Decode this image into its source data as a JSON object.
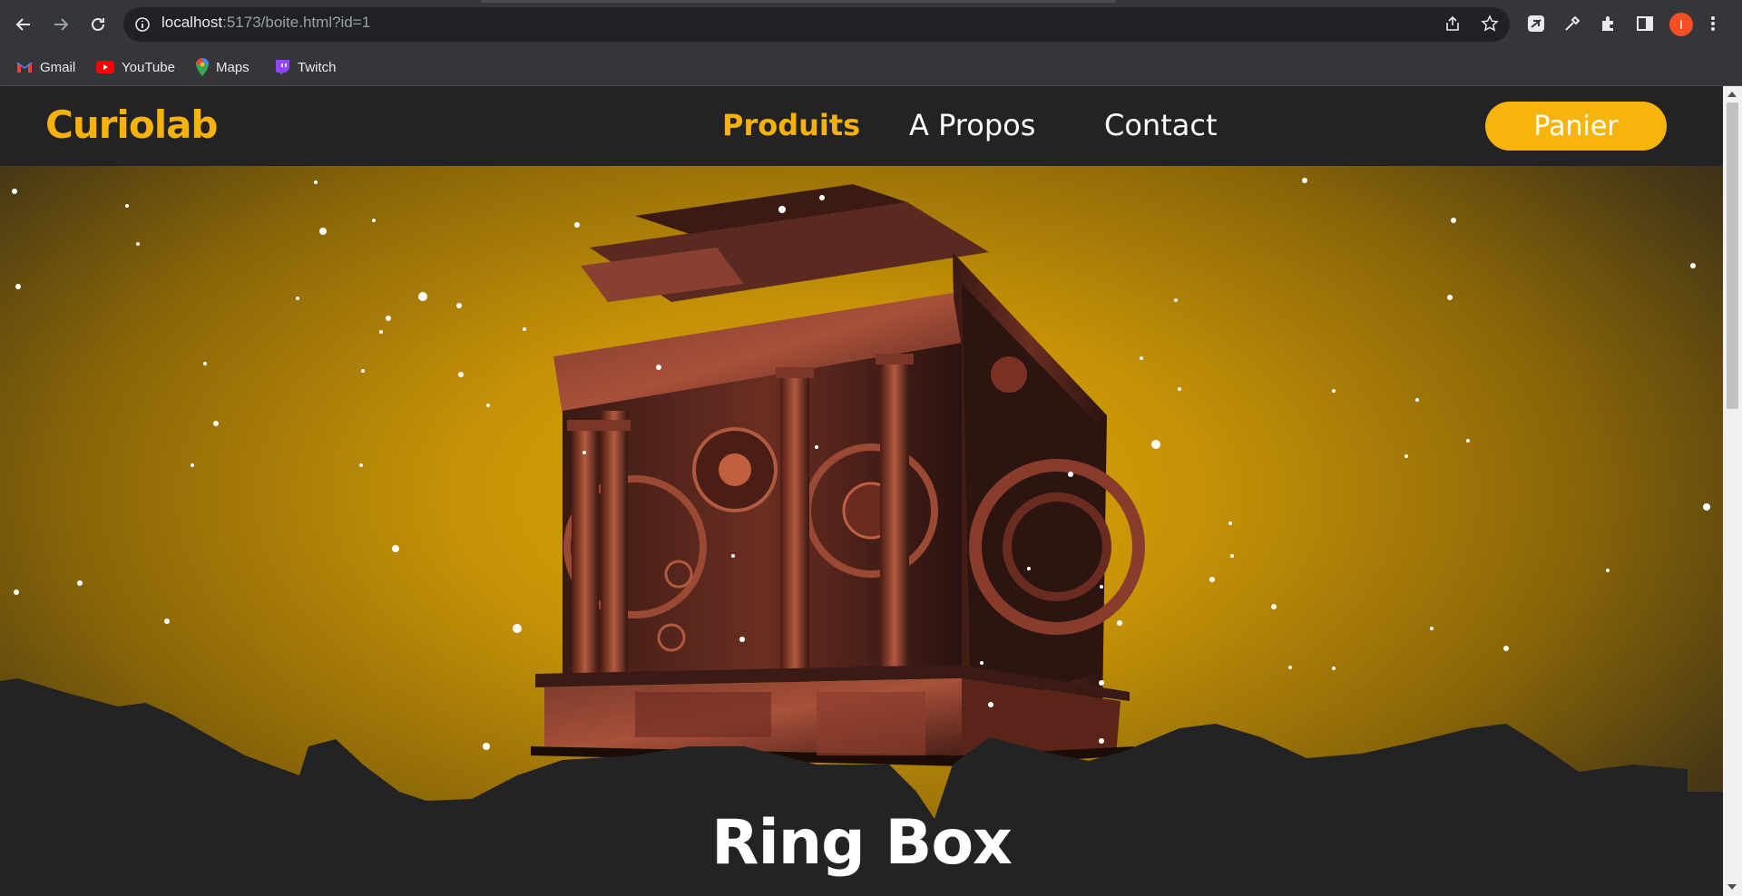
{
  "browser": {
    "url_host": "localhost",
    "url_rest": ":5173/boite.html?id=1",
    "avatar_letter": "I",
    "bookmarks": [
      {
        "label": "Gmail",
        "icon": "gmail-icon"
      },
      {
        "label": "YouTube",
        "icon": "youtube-icon"
      },
      {
        "label": "Maps",
        "icon": "maps-icon"
      },
      {
        "label": "Twitch",
        "icon": "twitch-icon"
      }
    ]
  },
  "site": {
    "logo": "Curiolab",
    "nav": [
      {
        "label": "Produits",
        "active": true
      },
      {
        "label": "A Propos",
        "active": false
      },
      {
        "label": "Contact",
        "active": false
      }
    ],
    "cart_label": "Panier"
  },
  "product": {
    "title": "Ring Box"
  },
  "colors": {
    "accent": "#f6b20b",
    "background": "#232325"
  }
}
